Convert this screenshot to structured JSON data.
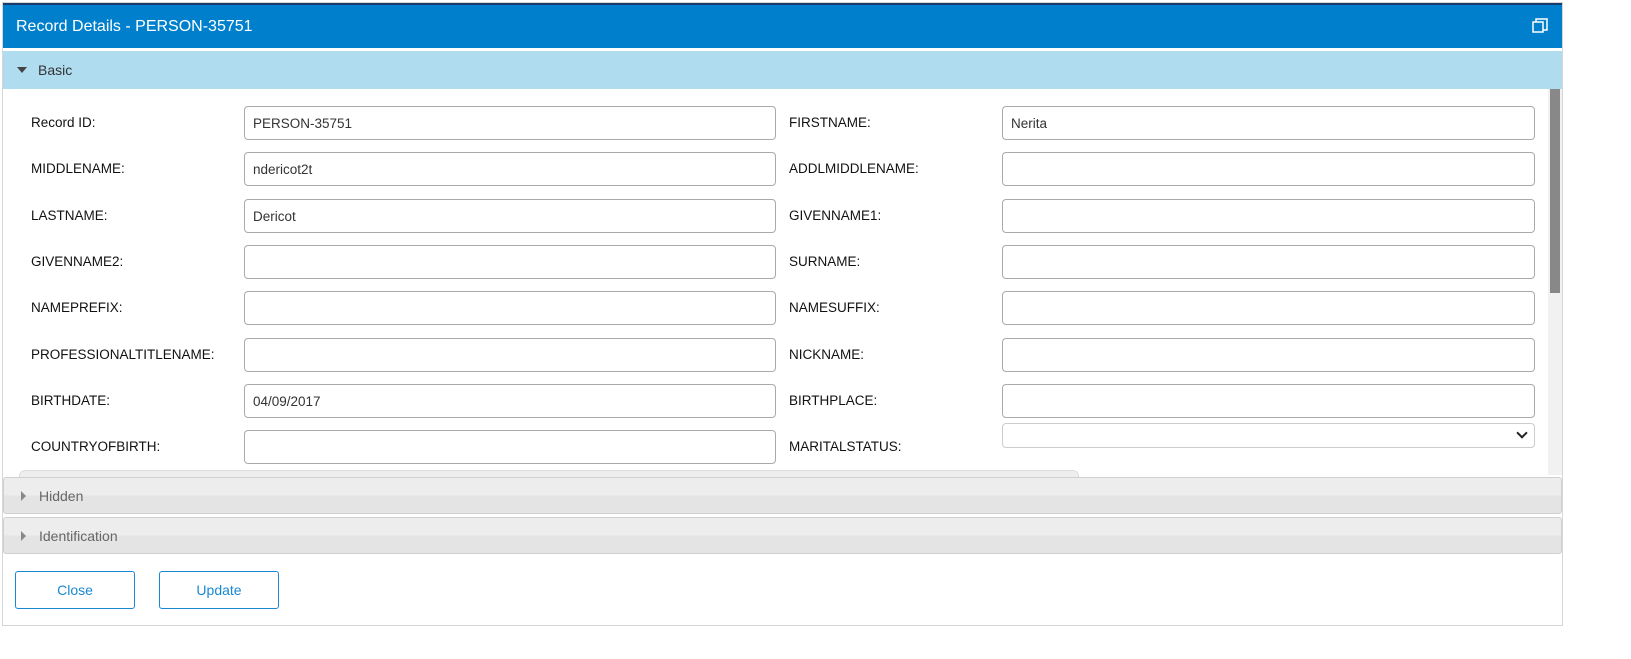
{
  "window": {
    "title": "Record Details - PERSON-35751",
    "restore_icon": "restore-window-icon"
  },
  "sections": {
    "basic": "Basic",
    "hidden": "Hidden",
    "identification": "Identification"
  },
  "fields": [
    {
      "label": "Record ID:",
      "value": "PERSON-35751"
    },
    {
      "label": "FIRSTNAME:",
      "value": "Nerita"
    },
    {
      "label": "MIDDLENAME:",
      "value": "ndericot2t"
    },
    {
      "label": "ADDLMIDDLENAME:",
      "value": ""
    },
    {
      "label": "LASTNAME:",
      "value": "Dericot"
    },
    {
      "label": "GIVENNAME1:",
      "value": ""
    },
    {
      "label": "GIVENNAME2:",
      "value": ""
    },
    {
      "label": "SURNAME:",
      "value": ""
    },
    {
      "label": "NAMEPREFIX:",
      "value": ""
    },
    {
      "label": "NAMESUFFIX:",
      "value": ""
    },
    {
      "label": "PROFESSIONALTITLENAME:",
      "value": ""
    },
    {
      "label": "NICKNAME:",
      "value": ""
    },
    {
      "label": "BIRTHDATE:",
      "value": "04/09/2017"
    },
    {
      "label": "BIRTHPLACE:",
      "value": ""
    },
    {
      "label": "COUNTRYOFBIRTH:",
      "value": ""
    },
    {
      "label": "MARITALSTATUS:",
      "value": "",
      "type": "select"
    }
  ],
  "buttons": {
    "close": "Close",
    "update": "Update"
  }
}
